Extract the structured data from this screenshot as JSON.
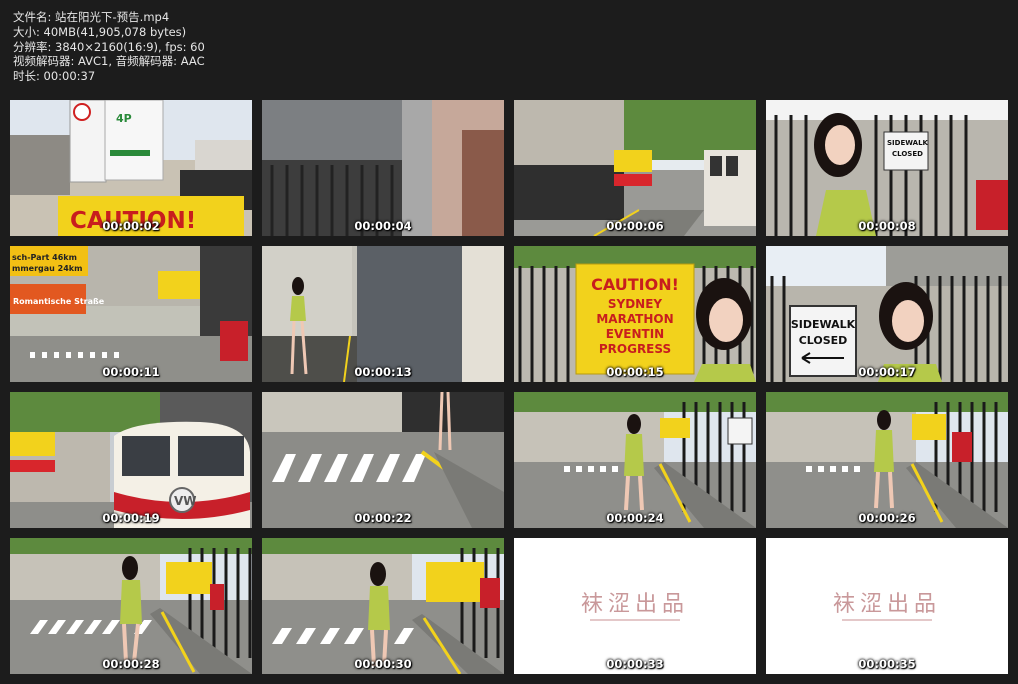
{
  "file_info": {
    "filename": "文件名: 站在阳光下-预告.mp4",
    "size": "大小: 40MB(41,905,078 bytes)",
    "resolution": "分辨率: 3840×2160(16:9), fps: 60",
    "codec": "视频解码器: AVC1, 音频解码器: AAC",
    "duration": "时长: 00:00:37"
  },
  "thumbnails": [
    {
      "time": "00:00:02",
      "sign": "CAUTION!",
      "sign2": "4P"
    },
    {
      "time": "00:00:04"
    },
    {
      "time": "00:00:06"
    },
    {
      "time": "00:00:08",
      "sign": "SIDEWALK CLOSED"
    },
    {
      "time": "00:00:11",
      "sign": "Romantische Straße"
    },
    {
      "time": "00:00:13"
    },
    {
      "time": "00:00:15",
      "sign_lines": [
        "CAUTION!",
        "SYDNEY",
        "MARATHON",
        "EVENTIN",
        "PROGRESS"
      ]
    },
    {
      "time": "00:00:17",
      "sign_lines": [
        "SIDEWALK",
        "CLOSED"
      ]
    },
    {
      "time": "00:00:19"
    },
    {
      "time": "00:00:22"
    },
    {
      "time": "00:00:24"
    },
    {
      "time": "00:00:26"
    },
    {
      "time": "00:00:28"
    },
    {
      "time": "00:00:30"
    },
    {
      "time": "00:00:33",
      "title": "袜涩出品"
    },
    {
      "time": "00:00:35",
      "title": "袜涩出品"
    }
  ],
  "colors": {
    "background": "#1c1c1c",
    "sign_yellow": "#f2d21c",
    "dress_green": "#b5c94a"
  }
}
